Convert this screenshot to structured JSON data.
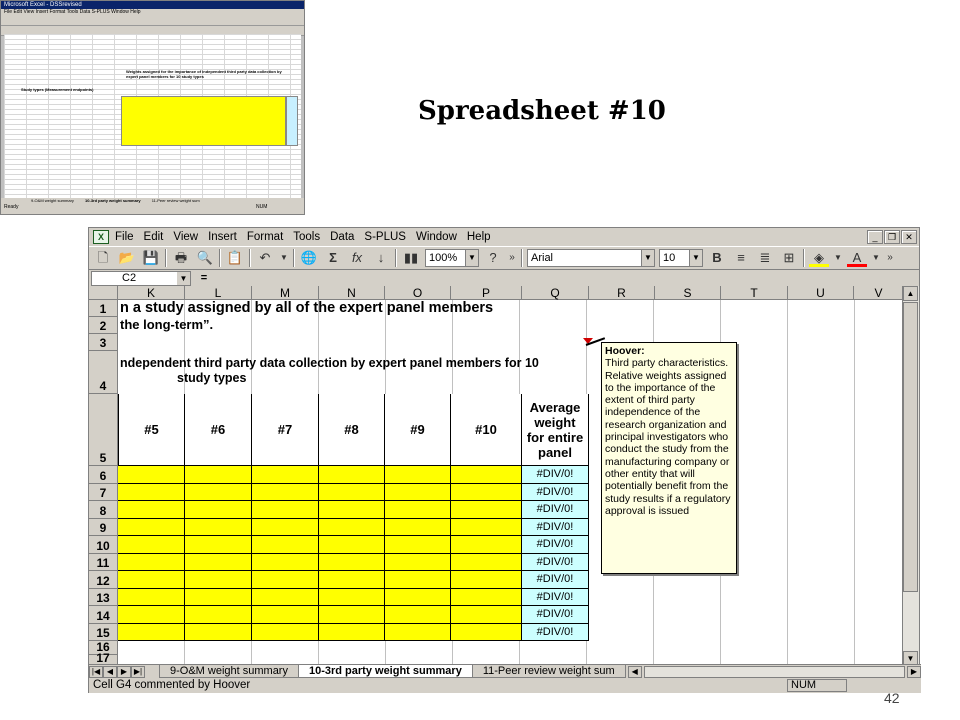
{
  "slide": {
    "title": "Spreadsheet #10",
    "page_number": "42"
  },
  "thumbnail": {
    "app_title": "Microsoft Excel - DSSrevised",
    "heading": "Weights assigned for the importance of independent third party data collection by expert panel members for 10 study types",
    "study_col": "Study types (Measurement endpoints)",
    "tabs": [
      "9-O&M weight summary",
      "10-3rd party weight summary",
      "11-Peer review weight sum"
    ],
    "status": "Ready",
    "num": "NUM"
  },
  "menu": [
    "File",
    "Edit",
    "View",
    "Insert",
    "Format",
    "Tools",
    "Data",
    "S-PLUS",
    "Window",
    "Help"
  ],
  "toolbar": {
    "zoom": "100%",
    "font": "Arial",
    "size": "10",
    "bold": "B"
  },
  "formula_bar": {
    "name_box": "C2",
    "equals": "="
  },
  "columns": [
    "K",
    "L",
    "M",
    "N",
    "O",
    "P",
    "Q",
    "R",
    "S",
    "T",
    "U",
    "V"
  ],
  "rows": [
    "1",
    "2",
    "3",
    "4",
    "5",
    "6",
    "7",
    "8",
    "9",
    "10",
    "11",
    "12",
    "13",
    "14",
    "15",
    "16",
    "17"
  ],
  "sheet": {
    "row1_text": "n a study assigned by all of the expert panel members",
    "row2_text": "the long-term”.",
    "row4_line1": "ndependent third party data collection by expert panel members for 10",
    "row4_line2": "study types",
    "headers": [
      "#5",
      "#6",
      "#7",
      "#8",
      "#9",
      "#10"
    ],
    "avg_header": "Average weight for entire panel",
    "avg_values": [
      "#DIV/0!",
      "#DIV/0!",
      "#DIV/0!",
      "#DIV/0!",
      "#DIV/0!",
      "#DIV/0!",
      "#DIV/0!",
      "#DIV/0!",
      "#DIV/0!",
      "#DIV/0!"
    ]
  },
  "comment": {
    "author": "Hoover:",
    "text": "Third party characteristics.  Relative weights assigned to the importance of the extent of third party independence of the research organization and principal investigators who conduct the study from the manufacturing company or other entity that will potentially benefit from the study results if a regulatory approval is issued"
  },
  "tabs": [
    "9-O&M weight summary",
    "10-3rd party weight summary",
    "11-Peer review weight sum"
  ],
  "status": {
    "text": "Cell G4 commented by Hoover",
    "num": "NUM"
  }
}
